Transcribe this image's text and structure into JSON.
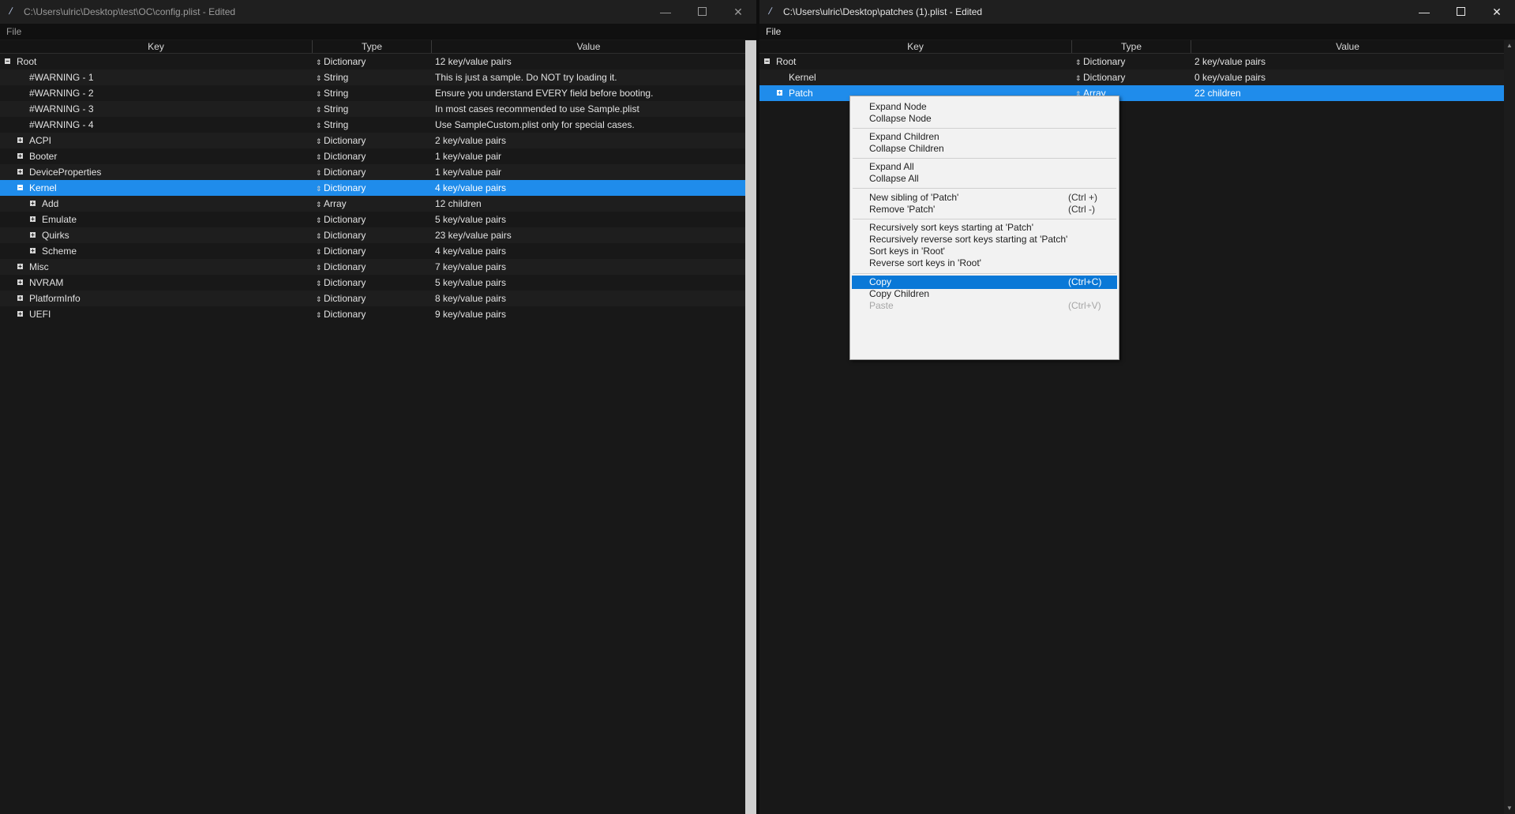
{
  "left_window": {
    "title": "C:\\Users\\ulric\\Desktop\\test\\OC\\config.plist - Edited",
    "menu_file": "File",
    "columns": {
      "key": "Key",
      "type": "Type",
      "value": "Value"
    },
    "rows": [
      {
        "key": "Root",
        "type": "Dictionary",
        "value": "12 key/value pairs",
        "toggle": "−"
      },
      {
        "key": "#WARNING - 1",
        "type": "String",
        "value": "This is just a sample. Do NOT try loading it."
      },
      {
        "key": "#WARNING - 2",
        "type": "String",
        "value": "Ensure you understand EVERY field before booting."
      },
      {
        "key": "#WARNING - 3",
        "type": "String",
        "value": "In most cases recommended to use Sample.plist"
      },
      {
        "key": "#WARNING - 4",
        "type": "String",
        "value": "Use SampleCustom.plist only for special cases."
      },
      {
        "key": "ACPI",
        "type": "Dictionary",
        "value": "2 key/value pairs",
        "toggle": "+"
      },
      {
        "key": "Booter",
        "type": "Dictionary",
        "value": "1 key/value pair",
        "toggle": "+"
      },
      {
        "key": "DeviceProperties",
        "type": "Dictionary",
        "value": "1 key/value pair",
        "toggle": "+"
      },
      {
        "key": "Kernel",
        "type": "Dictionary",
        "value": "4 key/value pairs",
        "toggle": "−"
      },
      {
        "key": "Add",
        "type": "Array",
        "value": "12 children",
        "toggle": "+"
      },
      {
        "key": "Emulate",
        "type": "Dictionary",
        "value": "5 key/value pairs",
        "toggle": "+"
      },
      {
        "key": "Quirks",
        "type": "Dictionary",
        "value": "23 key/value pairs",
        "toggle": "+"
      },
      {
        "key": "Scheme",
        "type": "Dictionary",
        "value": "4 key/value pairs",
        "toggle": "+"
      },
      {
        "key": "Misc",
        "type": "Dictionary",
        "value": "7 key/value pairs",
        "toggle": "+"
      },
      {
        "key": "NVRAM",
        "type": "Dictionary",
        "value": "5 key/value pairs",
        "toggle": "+"
      },
      {
        "key": "PlatformInfo",
        "type": "Dictionary",
        "value": "8 key/value pairs",
        "toggle": "+"
      },
      {
        "key": "UEFI",
        "type": "Dictionary",
        "value": "9 key/value pairs",
        "toggle": "+"
      }
    ]
  },
  "right_window": {
    "title": "C:\\Users\\ulric\\Desktop\\patches (1).plist - Edited",
    "menu_file": "File",
    "columns": {
      "key": "Key",
      "type": "Type",
      "value": "Value"
    },
    "rows": [
      {
        "key": "Root",
        "type": "Dictionary",
        "value": "2 key/value pairs",
        "toggle": "−"
      },
      {
        "key": "Kernel",
        "type": "Dictionary",
        "value": "0 key/value pairs"
      },
      {
        "key": "Patch",
        "type": "Array",
        "value": "22 children",
        "toggle": "+"
      }
    ]
  },
  "context_menu": {
    "items": [
      {
        "label": "Expand Node",
        "shortcut": ""
      },
      {
        "label": "Collapse Node",
        "shortcut": ""
      },
      {
        "label": "Expand Children",
        "shortcut": ""
      },
      {
        "label": "Collapse Children",
        "shortcut": ""
      },
      {
        "label": "Expand All",
        "shortcut": ""
      },
      {
        "label": "Collapse All",
        "shortcut": ""
      },
      {
        "label": "New sibling of 'Patch'",
        "shortcut": "(Ctrl +)"
      },
      {
        "label": "Remove 'Patch'",
        "shortcut": "(Ctrl -)"
      },
      {
        "label": "Recursively sort keys starting at 'Patch'",
        "shortcut": ""
      },
      {
        "label": "Recursively reverse sort keys starting at 'Patch'",
        "shortcut": ""
      },
      {
        "label": "Sort keys in 'Root'",
        "shortcut": ""
      },
      {
        "label": "Reverse sort keys in 'Root'",
        "shortcut": ""
      },
      {
        "label": "Copy",
        "shortcut": "(Ctrl+C)"
      },
      {
        "label": "Copy Children",
        "shortcut": ""
      },
      {
        "label": "Paste",
        "shortcut": "(Ctrl+V)"
      }
    ]
  },
  "colors": {
    "selection": "#1f8ceb",
    "menu_highlight": "#0a78d7",
    "background": "#191919"
  }
}
